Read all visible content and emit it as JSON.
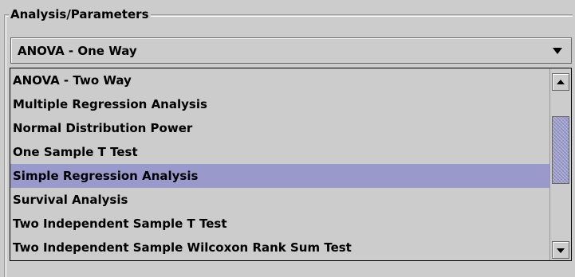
{
  "panel": {
    "title": "Analysis/Parameters"
  },
  "combo": {
    "selected_value": "ANOVA - One Way",
    "arrow_icon": "chevron-down-icon"
  },
  "list": {
    "items": [
      "ANOVA - Two Way",
      "Multiple Regression Analysis",
      "Normal Distribution Power",
      "One Sample T Test",
      "Simple Regression Analysis",
      "Survival Analysis",
      "Two Independent Sample T Test",
      "Two Independent Sample Wilcoxon Rank Sum Test"
    ],
    "highlighted": "Simple Regression Analysis"
  },
  "colors": {
    "background": "#cccccc",
    "selection": "#9999cc",
    "text": "#000000"
  }
}
